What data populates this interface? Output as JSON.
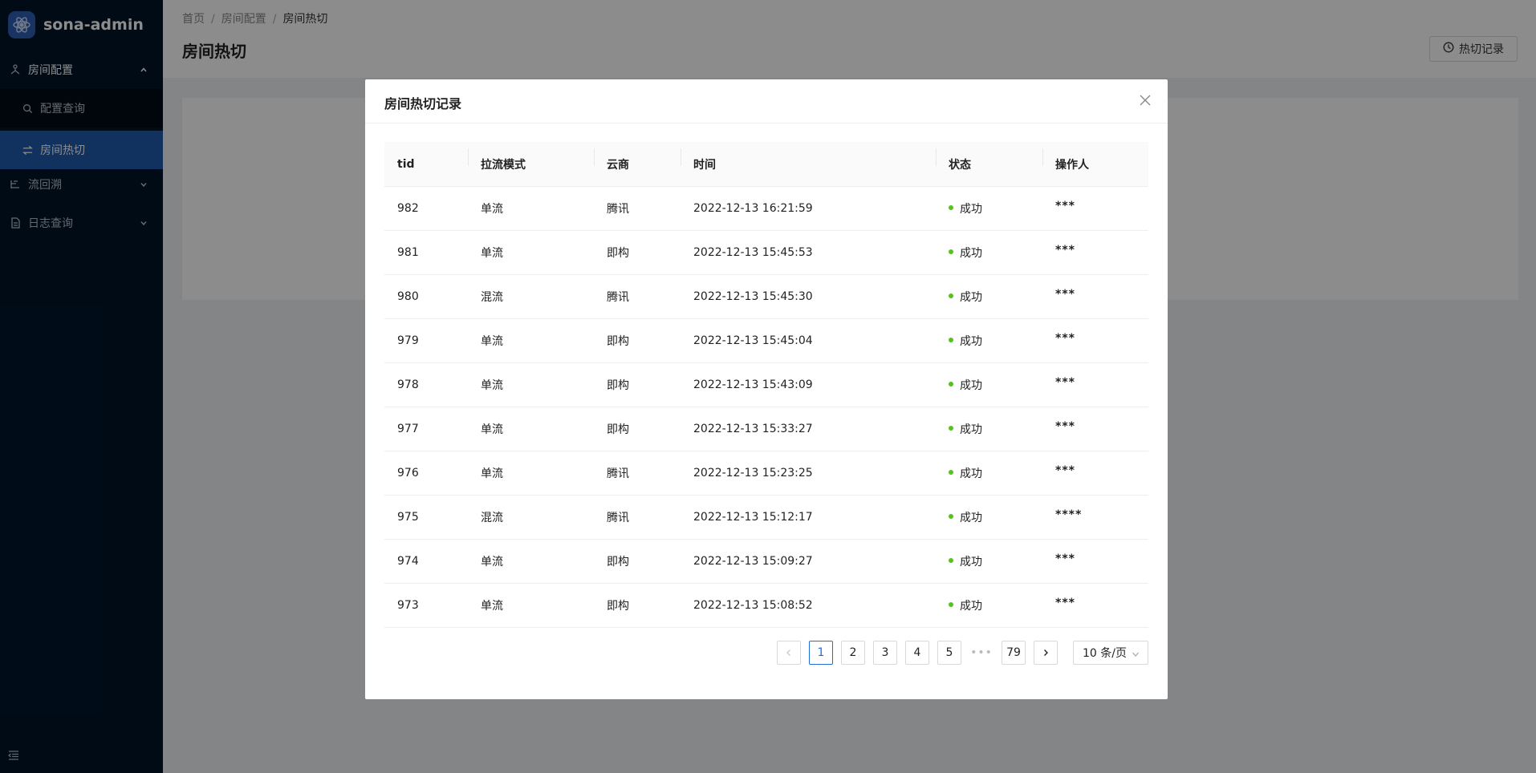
{
  "app": {
    "name": "sona-admin"
  },
  "sidebar": {
    "items": [
      {
        "label": "房间配置",
        "icon": "cluster-icon",
        "expanded": true
      },
      {
        "label": "配置查询",
        "icon": "search-icon"
      },
      {
        "label": "房间热切",
        "icon": "swap-icon",
        "active": true
      },
      {
        "label": "流回溯",
        "icon": "branch-icon",
        "expanded": false
      },
      {
        "label": "日志查询",
        "icon": "file-icon",
        "expanded": false
      }
    ]
  },
  "breadcrumb": [
    "首页",
    "房间配置",
    "房间热切"
  ],
  "breadcrumb_separator": "/",
  "page": {
    "title": "房间热切",
    "history_button": "热切记录"
  },
  "modal": {
    "title": "房间热切记录",
    "columns": [
      "tid",
      "拉流模式",
      "云商",
      "时间",
      "状态",
      "操作人"
    ],
    "rows": [
      {
        "tid": "982",
        "mode": "单流",
        "vendor": "腾讯",
        "time": "2022-12-13 16:21:59",
        "status": "成功",
        "operator": "***"
      },
      {
        "tid": "981",
        "mode": "单流",
        "vendor": "即构",
        "time": "2022-12-13 15:45:53",
        "status": "成功",
        "operator": "***"
      },
      {
        "tid": "980",
        "mode": "混流",
        "vendor": "腾讯",
        "time": "2022-12-13 15:45:30",
        "status": "成功",
        "operator": "***"
      },
      {
        "tid": "979",
        "mode": "单流",
        "vendor": "即构",
        "time": "2022-12-13 15:45:04",
        "status": "成功",
        "operator": "***"
      },
      {
        "tid": "978",
        "mode": "单流",
        "vendor": "即构",
        "time": "2022-12-13 15:43:09",
        "status": "成功",
        "operator": "***"
      },
      {
        "tid": "977",
        "mode": "单流",
        "vendor": "即构",
        "time": "2022-12-13 15:33:27",
        "status": "成功",
        "operator": "***"
      },
      {
        "tid": "976",
        "mode": "单流",
        "vendor": "腾讯",
        "time": "2022-12-13 15:23:25",
        "status": "成功",
        "operator": "***"
      },
      {
        "tid": "975",
        "mode": "混流",
        "vendor": "腾讯",
        "time": "2022-12-13 15:12:17",
        "status": "成功",
        "operator": "****"
      },
      {
        "tid": "974",
        "mode": "单流",
        "vendor": "即构",
        "time": "2022-12-13 15:09:27",
        "status": "成功",
        "operator": "***"
      },
      {
        "tid": "973",
        "mode": "单流",
        "vendor": "即构",
        "time": "2022-12-13 15:08:52",
        "status": "成功",
        "operator": "***"
      }
    ],
    "pagination": {
      "pages": [
        "1",
        "2",
        "3",
        "4",
        "5"
      ],
      "ellipsis": "•••",
      "last": "79",
      "current": "1",
      "page_size": "10 条/页"
    }
  },
  "colors": {
    "sidebar_bg": "#001529",
    "active_item": "#1f5aad",
    "primary": "#1f6fd8",
    "success_dot": "#52c41a"
  }
}
